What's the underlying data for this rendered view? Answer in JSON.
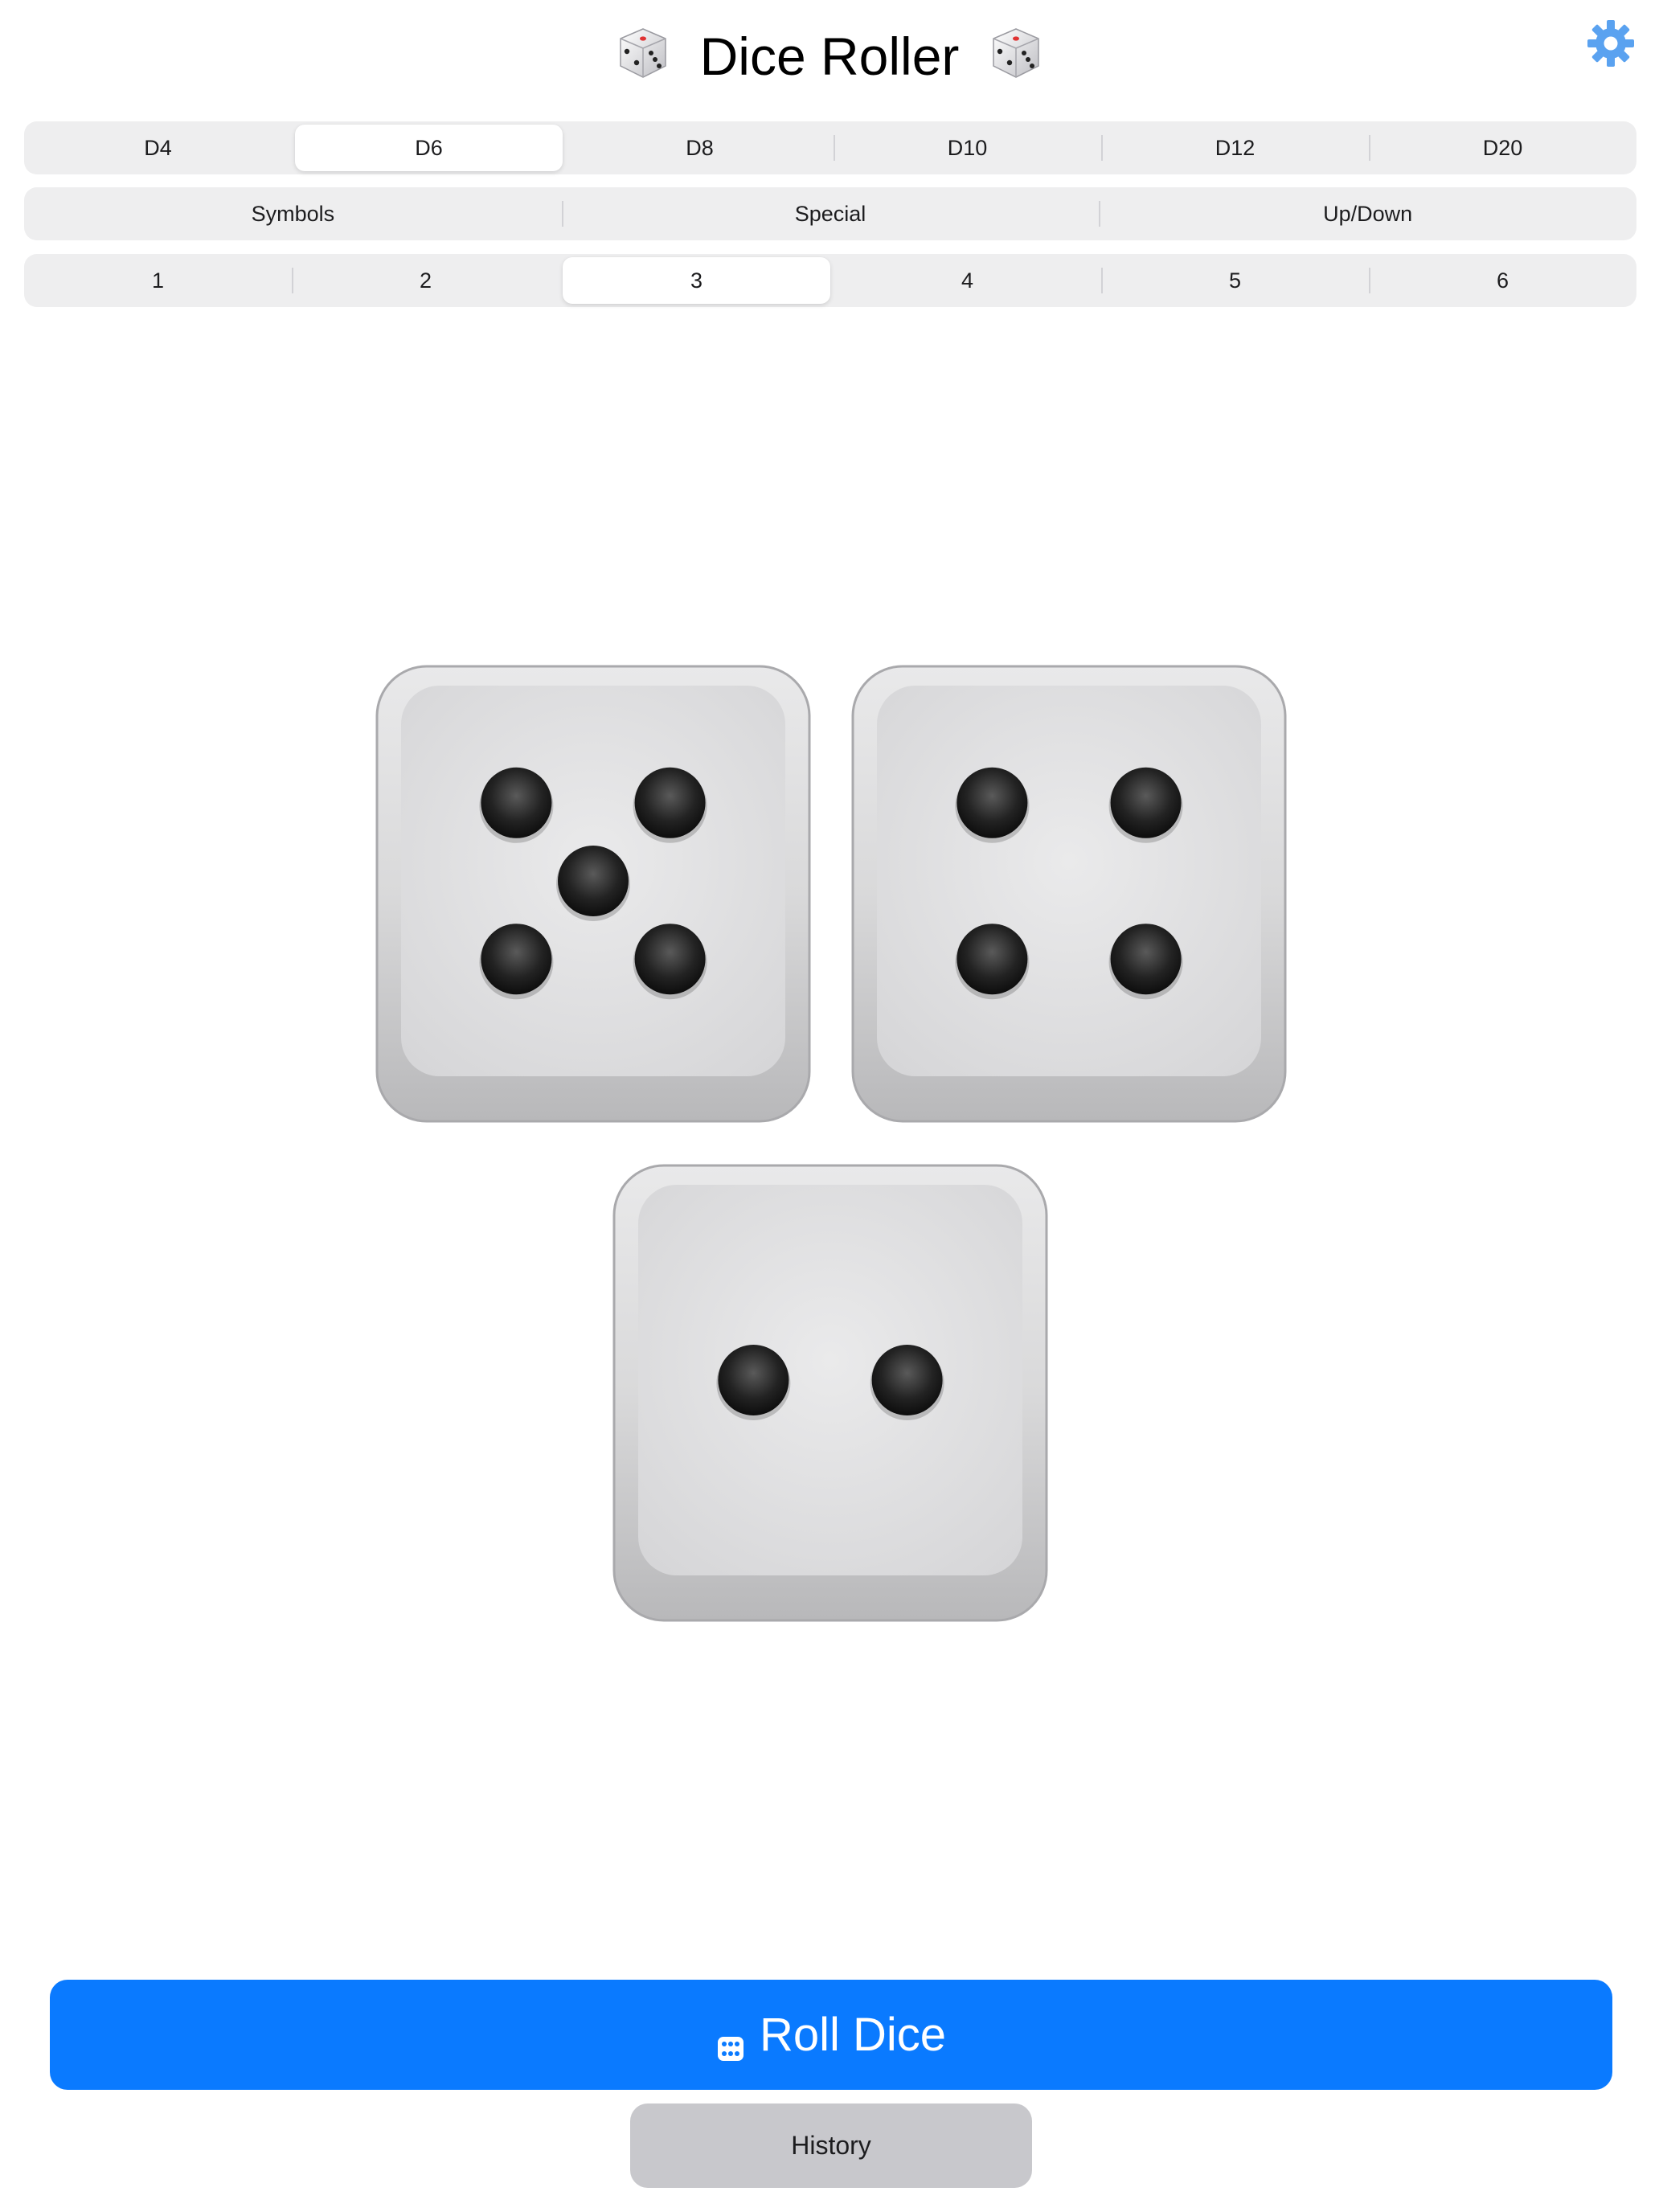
{
  "header": {
    "title": "Dice Roller",
    "left_icon": "die-emoji-icon",
    "right_icon": "die-emoji-icon",
    "settings_icon": "gear-icon"
  },
  "colors": {
    "accent": "#0a7aff",
    "segment_bg": "#eeeeef",
    "history_bg": "#c8c8cc",
    "settings_icon": "#5aa2f0"
  },
  "die_type_selector": {
    "options": [
      "D4",
      "D6",
      "D8",
      "D10",
      "D12",
      "D20"
    ],
    "selected": "D6"
  },
  "mode_selector": {
    "options": [
      "Symbols",
      "Special",
      "Up/Down"
    ],
    "selected": null
  },
  "count_selector": {
    "options": [
      "1",
      "2",
      "3",
      "4",
      "5",
      "6"
    ],
    "selected": "3"
  },
  "dice": [
    {
      "value": 5
    },
    {
      "value": 4
    },
    {
      "value": 2
    }
  ],
  "actions": {
    "roll_label": "Roll Dice",
    "roll_icon": "dice-icon",
    "history_label": "History"
  }
}
